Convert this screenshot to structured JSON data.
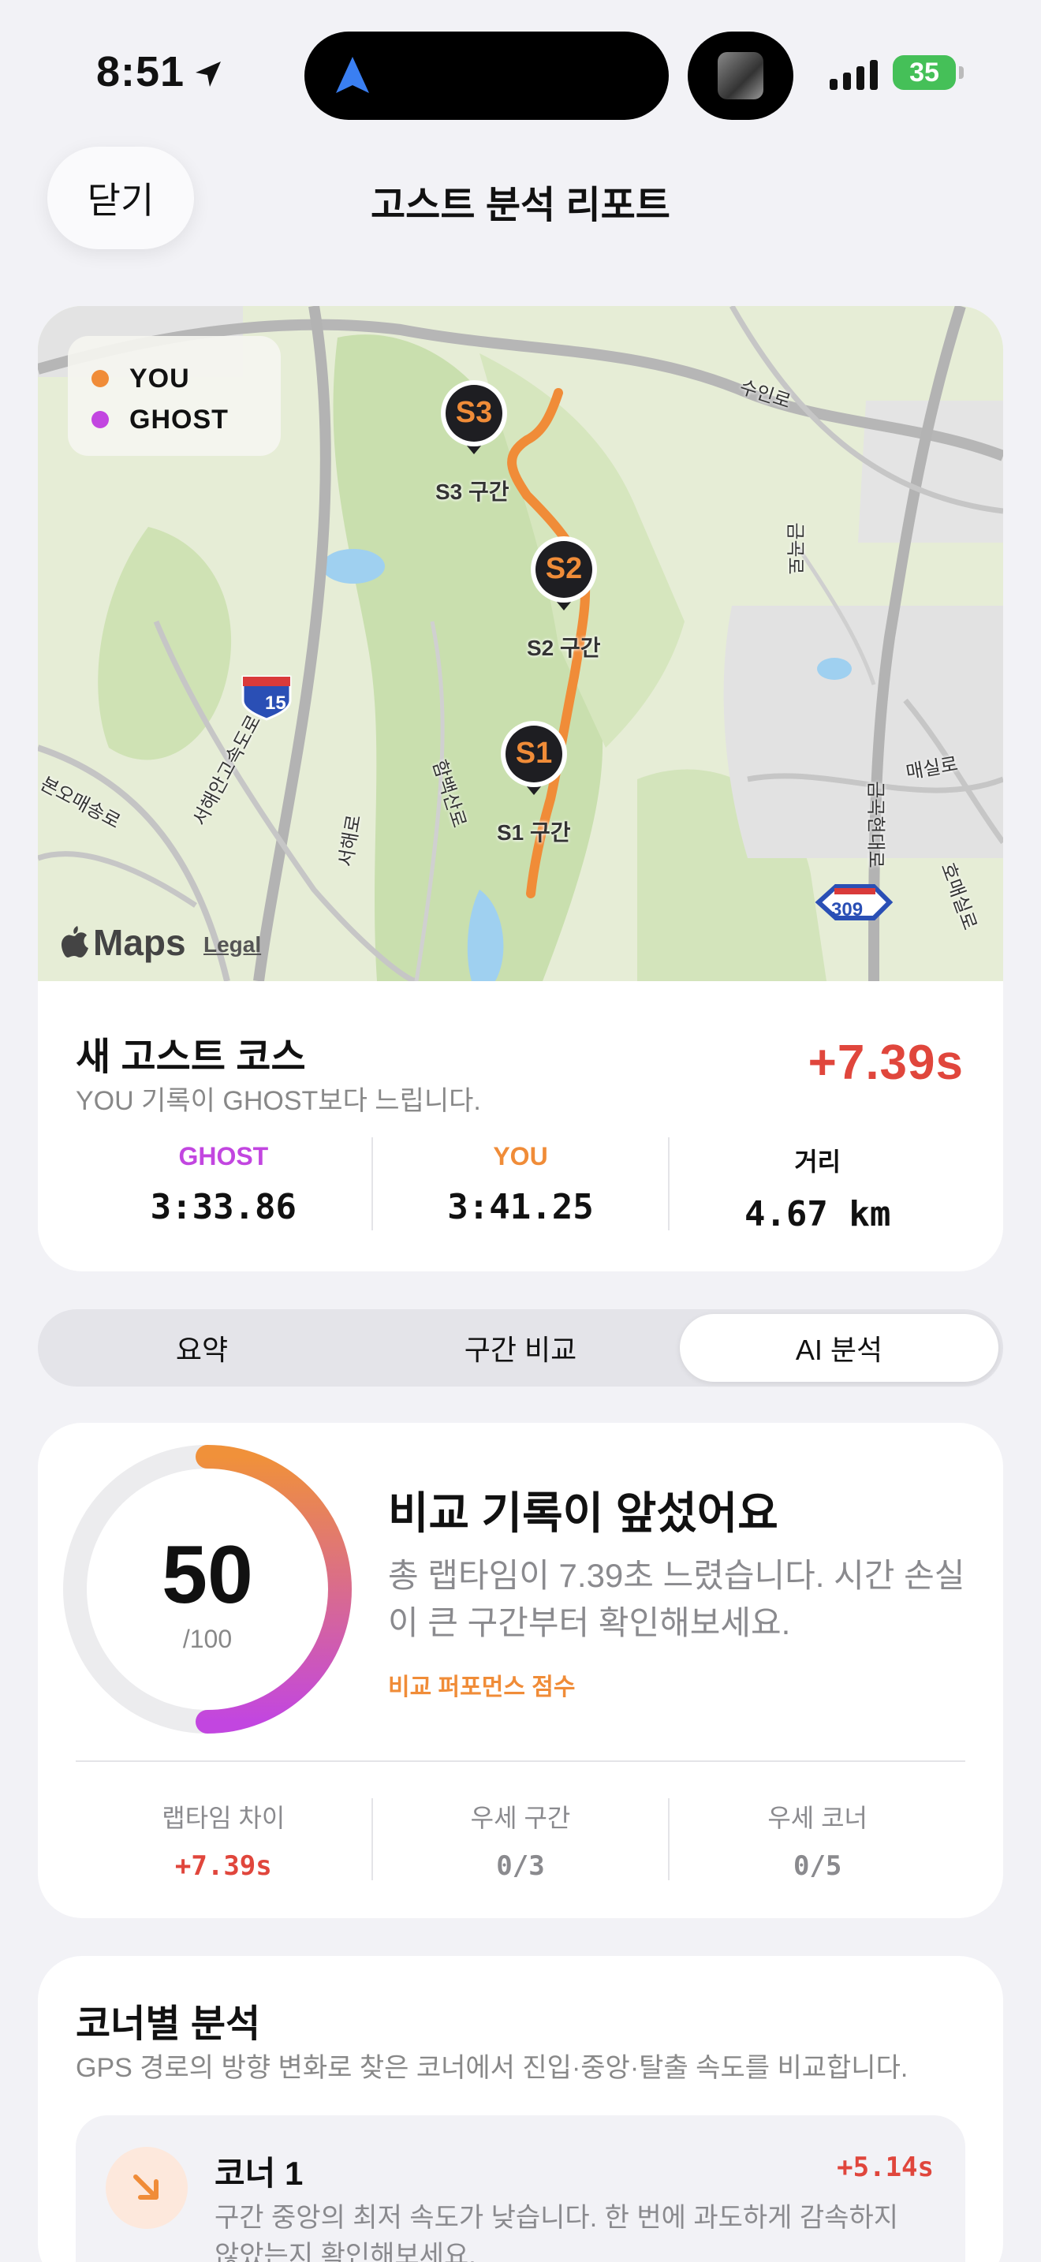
{
  "status_bar": {
    "time": "8:51",
    "battery": "35"
  },
  "header": {
    "close_label": "닫기",
    "title": "고스트 분석 리포트"
  },
  "map": {
    "legend": [
      {
        "label": "YOU",
        "color": "#f08c38"
      },
      {
        "label": "GHOST",
        "color": "#c246e0"
      }
    ],
    "markers": [
      {
        "badge": "S3",
        "label": "S3 구간"
      },
      {
        "badge": "S2",
        "label": "S2 구간"
      },
      {
        "badge": "S1",
        "label": "S1 구간"
      }
    ],
    "road_labels": [
      "수인로",
      "매실로",
      "15",
      "309",
      "함백산로",
      "서해로",
      "서해안고속도로",
      "본오매송로",
      "호매실로",
      "금곡로",
      "금곡현대로"
    ],
    "attribution": {
      "brand": "Maps",
      "legal": "Legal"
    }
  },
  "summary": {
    "course_name": "새 고스트 코스",
    "subtitle": "YOU 기록이 GHOST보다 느립니다.",
    "delta": "+7.39s",
    "stats": [
      {
        "label": "GHOST",
        "value": "3:33.86",
        "color": "#c246e0"
      },
      {
        "label": "YOU",
        "value": "3:41.25",
        "color": "#f08c38"
      },
      {
        "label": "거리",
        "value": "4.67 km",
        "color": "#111111"
      }
    ]
  },
  "tabs": [
    {
      "label": "요약",
      "active": false
    },
    {
      "label": "구간 비교",
      "active": false
    },
    {
      "label": "AI 분석",
      "active": true
    }
  ],
  "score": {
    "value": "50",
    "max": "/100",
    "fraction": 0.5,
    "title": "비교 기록이 앞섰어요",
    "description": "총 랩타임이 7.39초 느렸습니다. 시간 손실이 큰 구간부터 확인해보세요.",
    "tag": "비교 퍼포먼스 점수",
    "metrics": [
      {
        "label": "랩타임 차이",
        "value": "+7.39s",
        "highlight": true
      },
      {
        "label": "우세 구간",
        "value": "0/3",
        "highlight": false
      },
      {
        "label": "우세 코너",
        "value": "0/5",
        "highlight": false
      }
    ]
  },
  "corners": {
    "title": "코너별 분석",
    "subtitle": "GPS 경로의 방향 변화로 찾은 코너에서 진입·중앙·탈출 속도를 비교합니다.",
    "items": [
      {
        "name": "코너 1",
        "delta": "+5.14s",
        "description": "구간 중앙의 최저 속도가 낮습니다. 한 번에 과도하게 감속하지 않았는지 확인해보세요."
      }
    ]
  }
}
